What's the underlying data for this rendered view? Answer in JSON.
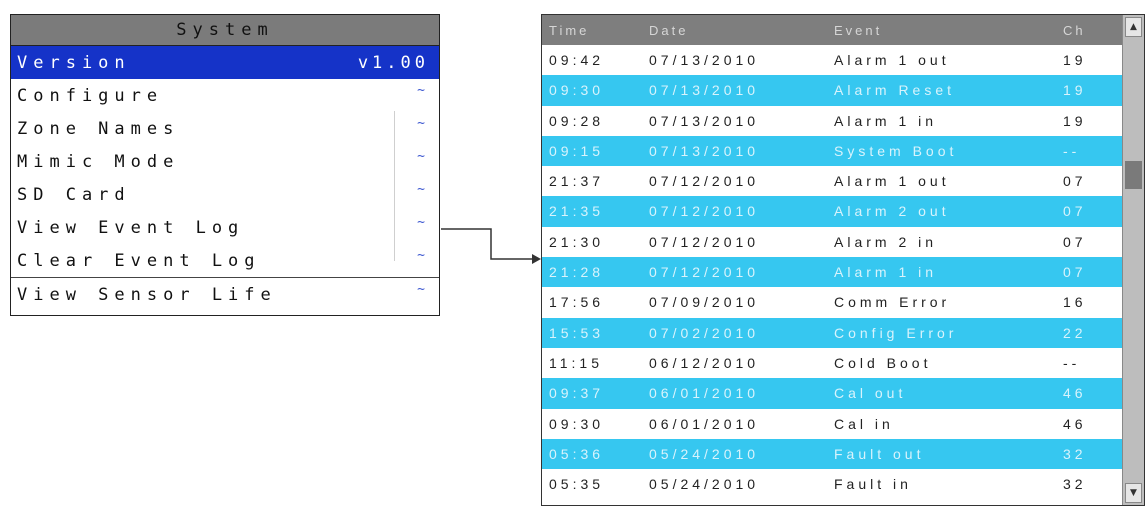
{
  "menu": {
    "title": "System",
    "items": [
      {
        "label": "Version",
        "value": "v1.00",
        "selected": true
      },
      {
        "label": "Configure",
        "value": "~"
      },
      {
        "label": "Zone Names",
        "value": "~"
      },
      {
        "label": "Mimic Mode",
        "value": "~"
      },
      {
        "label": "SD Card",
        "value": "~"
      },
      {
        "label": "View Event Log",
        "value": "~"
      },
      {
        "label": "Clear Event Log",
        "value": "~"
      },
      {
        "label": "View Sensor Life",
        "value": "~"
      }
    ]
  },
  "event_log": {
    "columns": {
      "time": "Time",
      "date": "Date",
      "event": "Event",
      "ch": "Ch"
    },
    "rows": [
      {
        "time": "09:42",
        "date": "07/13/2010",
        "event": "Alarm 1 out",
        "ch": "19"
      },
      {
        "time": "09:30",
        "date": "07/13/2010",
        "event": "Alarm Reset",
        "ch": "19"
      },
      {
        "time": "09:28",
        "date": "07/13/2010",
        "event": "Alarm 1 in",
        "ch": "19"
      },
      {
        "time": "09:15",
        "date": "07/13/2010",
        "event": "System Boot",
        "ch": "--"
      },
      {
        "time": "21:37",
        "date": "07/12/2010",
        "event": "Alarm 1 out",
        "ch": "07"
      },
      {
        "time": "21:35",
        "date": "07/12/2010",
        "event": "Alarm 2 out",
        "ch": "07"
      },
      {
        "time": "21:30",
        "date": "07/12/2010",
        "event": "Alarm 2 in",
        "ch": "07"
      },
      {
        "time": "21:28",
        "date": "07/12/2010",
        "event": "Alarm 1 in",
        "ch": "07"
      },
      {
        "time": "17:56",
        "date": "07/09/2010",
        "event": "Comm Error",
        "ch": "16"
      },
      {
        "time": "15:53",
        "date": "07/02/2010",
        "event": "Config Error",
        "ch": "22"
      },
      {
        "time": "11:15",
        "date": "06/12/2010",
        "event": "Cold Boot",
        "ch": "--"
      },
      {
        "time": "09:37",
        "date": "06/01/2010",
        "event": "Cal out",
        "ch": "46"
      },
      {
        "time": "09:30",
        "date": "06/01/2010",
        "event": "Cal in",
        "ch": "46"
      },
      {
        "time": "05:36",
        "date": "05/24/2010",
        "event": "Fault out",
        "ch": "32"
      },
      {
        "time": "05:35",
        "date": "05/24/2010",
        "event": "Fault in",
        "ch": "32"
      }
    ]
  },
  "colors": {
    "menu_title_bg": "#7b7b7b",
    "selected_bg": "#1533c8",
    "row_highlight": "#36c7f0",
    "log_header_bg": "#7e7e7e"
  },
  "icons": {
    "scroll_up": "triangle-up-icon",
    "scroll_down": "triangle-down-icon",
    "arrow": "connector-arrow"
  }
}
